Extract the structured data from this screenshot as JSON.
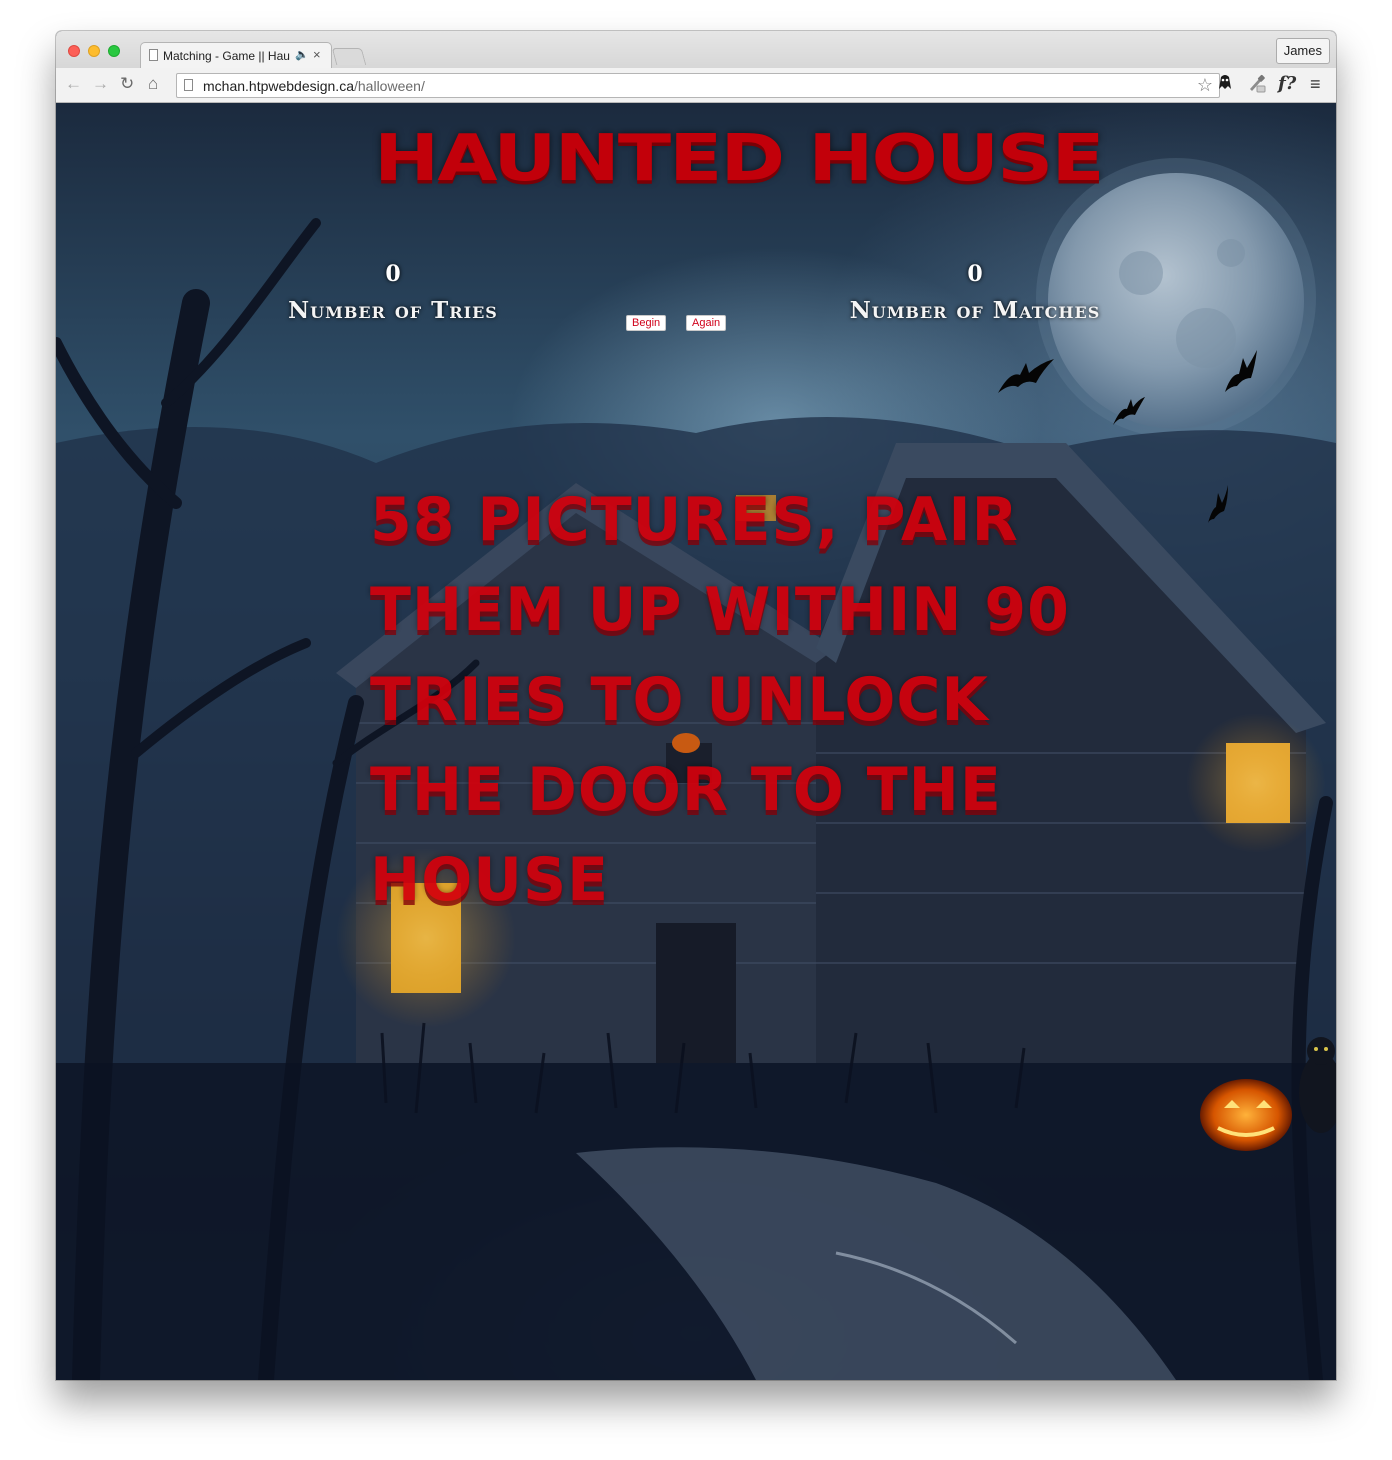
{
  "browser": {
    "tab_title": "Matching - Game || Hau",
    "tab_audio_icon": "speaker-icon",
    "tab_close_glyph": "×",
    "profile_name": "James",
    "url_domain": "mchan.htpwebdesign.ca",
    "url_path": "/halloween/",
    "icons": [
      "back-arrow-icon",
      "forward-arrow-icon",
      "reload-icon",
      "home-icon",
      "page-icon",
      "bookmark-star-icon",
      "ghost-extension-icon",
      "eyedropper-extension-icon",
      "font-extension-icon",
      "menu-icon"
    ]
  },
  "page": {
    "title": "Haunted House",
    "tries": {
      "value": "0",
      "label": "Number of Tries"
    },
    "matches": {
      "value": "0",
      "label": "Number of Matches"
    },
    "begin_button": "Begin",
    "again_button": "Again",
    "instructions": "58 pictures, pair them up within 90 tries to unlock the door to the house"
  },
  "colors": {
    "title_red": "#c2000a",
    "instructions_red": "#d4000c",
    "button_text": "#d0021b",
    "label_white": "#f4f4f4"
  }
}
